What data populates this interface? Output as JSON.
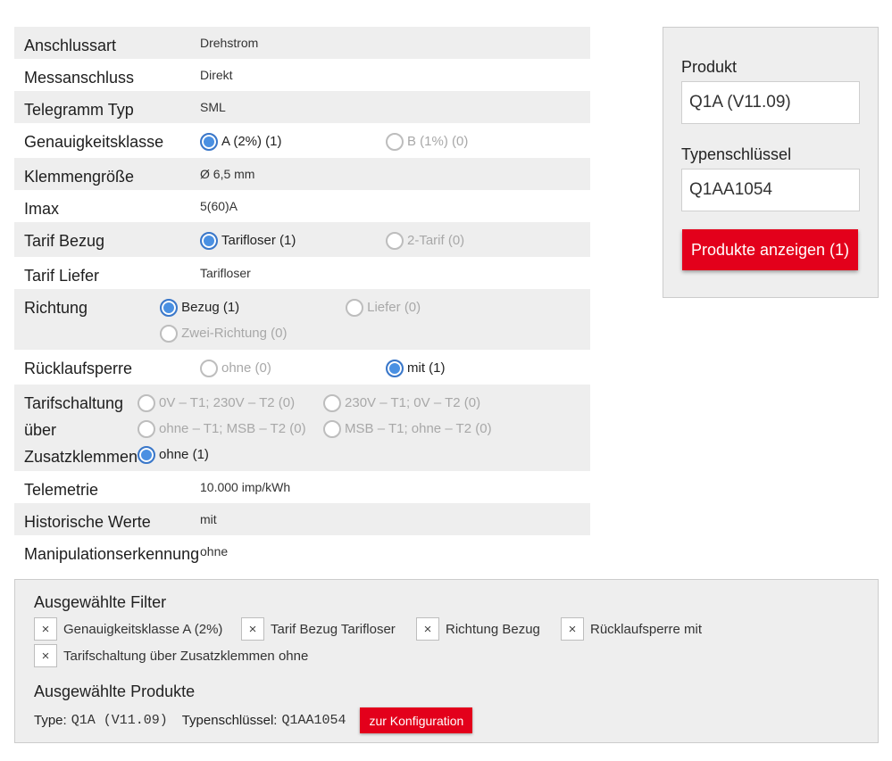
{
  "properties": [
    {
      "label": "Anschlussart",
      "value": "Drehstrom"
    },
    {
      "label": "Messanschluss",
      "value": "Direkt"
    },
    {
      "label": "Telegramm Typ",
      "value": "SML"
    },
    {
      "label": "Genauigkeitsklasse",
      "options": [
        {
          "label": "A (2%) (1)",
          "checked": true,
          "disabled": false
        },
        {
          "label": "B (1%) (0)",
          "checked": false,
          "disabled": true
        }
      ]
    },
    {
      "label": "Klemmengröße",
      "value": "Ø 6,5 mm"
    },
    {
      "label": "Imax",
      "value": "5(60)A"
    },
    {
      "label": "Tarif Bezug",
      "options": [
        {
          "label": "Tarifloser (1)",
          "checked": true,
          "disabled": false
        },
        {
          "label": "2-Tarif (0)",
          "checked": false,
          "disabled": true
        }
      ]
    },
    {
      "label": "Tarif Liefer",
      "value": "Tarifloser"
    },
    {
      "label": "Richtung",
      "options": [
        {
          "label": "Bezug (1)",
          "checked": true,
          "disabled": false
        },
        {
          "label": "Liefer (0)",
          "checked": false,
          "disabled": true
        },
        {
          "label": "Zwei-Richtung (0)",
          "checked": false,
          "disabled": true
        }
      ]
    },
    {
      "label": "Rücklaufsperre",
      "options": [
        {
          "label": "ohne (0)",
          "checked": false,
          "disabled": true
        },
        {
          "label": "mit (1)",
          "checked": true,
          "disabled": false
        }
      ]
    },
    {
      "label": "Tarifschaltung über Zusatzklemmen",
      "options": [
        {
          "label": "0V – T1; 230V – T2 (0)",
          "checked": false,
          "disabled": true
        },
        {
          "label": "230V – T1; 0V – T2 (0)",
          "checked": false,
          "disabled": true
        },
        {
          "label": "ohne – T1; MSB – T2 (0)",
          "checked": false,
          "disabled": true
        },
        {
          "label": "MSB – T1; ohne – T2 (0)",
          "checked": false,
          "disabled": true
        },
        {
          "label": "ohne (1)",
          "checked": true,
          "disabled": false
        }
      ]
    },
    {
      "label": "Telemetrie",
      "value": "10.000 imp/kWh"
    },
    {
      "label": "Historische Werte",
      "value": "mit"
    },
    {
      "label": "Manipulationserkennung",
      "value": "ohne"
    }
  ],
  "sidebar": {
    "product_label": "Produkt",
    "product_value": "Q1A (V11.09)",
    "typekey_label": "Typenschlüssel",
    "typekey_value": "Q1AA1054",
    "show_button": "Produkte anzeigen (1)"
  },
  "filters": {
    "title": "Ausgewählte Filter",
    "chip_close_glyph": "×",
    "chips": [
      "Genauigkeitsklasse A (2%)",
      "Tarif Bezug Tarifloser",
      "Richtung Bezug",
      "Rücklaufsperre mit",
      "Tarifschaltung über Zusatzklemmen ohne"
    ]
  },
  "selected": {
    "title": "Ausgewählte Produkte",
    "type_label": "Type:",
    "type_value": "Q1A (V11.09)",
    "typekey_label": "Typenschlüssel:",
    "typekey_value": "Q1AA1054",
    "config_button": "zur Konfiguration"
  },
  "colors": {
    "accent_red": "#e3001b",
    "radio_blue": "#4a90e2",
    "panel_gray": "#eeeeee"
  }
}
